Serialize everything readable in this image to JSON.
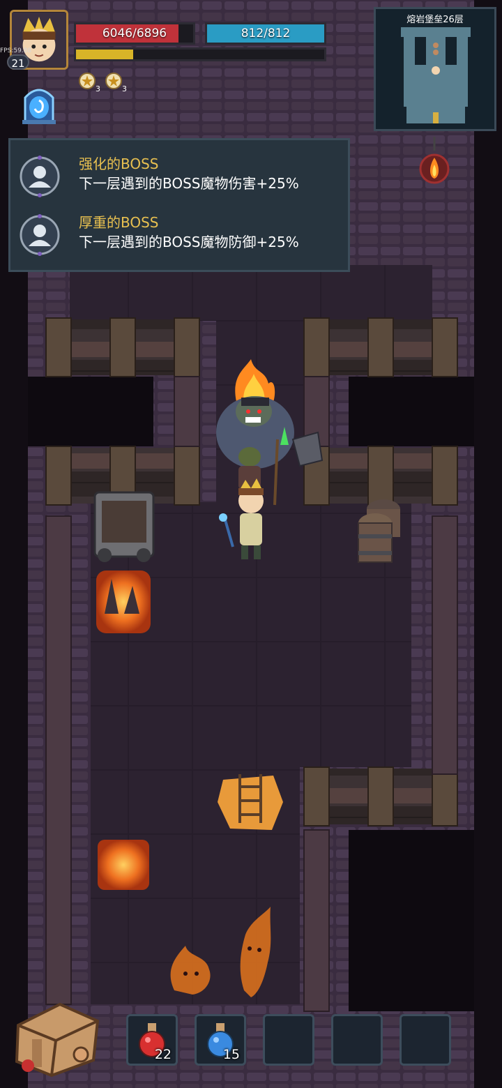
{
  "player": {
    "level": "21",
    "fps": "FPS:59.88",
    "hp": "6046/6896",
    "hp_fraction": 0.877,
    "mp": "812/812",
    "mp_fraction": 1.0,
    "xp_fraction": 0.23,
    "buffs": [
      {
        "icon": "star-medal-icon",
        "count": "3"
      },
      {
        "icon": "star-medal-icon",
        "count": "3"
      }
    ]
  },
  "minimap": {
    "title": "熔岩堡垒26层"
  },
  "boss_panel": {
    "entries": [
      {
        "icon": "boss-silhouette-icon",
        "title": "强化的BOSS",
        "desc": "下一层遇到的BOSS魔物伤害+25%"
      },
      {
        "icon": "boss-silhouette-icon",
        "title": "厚重的BOSS",
        "desc": "下一层遇到的BOSS魔物防御+25%"
      }
    ]
  },
  "inventory": {
    "slots": [
      {
        "icon": "red-potion-icon",
        "count": "22"
      },
      {
        "icon": "blue-potion-icon",
        "count": "15"
      },
      {
        "icon": "",
        "count": ""
      },
      {
        "icon": "",
        "count": ""
      },
      {
        "icon": "",
        "count": ""
      }
    ]
  },
  "colors": {
    "hp": "#c0323a",
    "mp": "#2a9cc4",
    "xp": "#d8b428",
    "panel_title": "#e8c050"
  }
}
